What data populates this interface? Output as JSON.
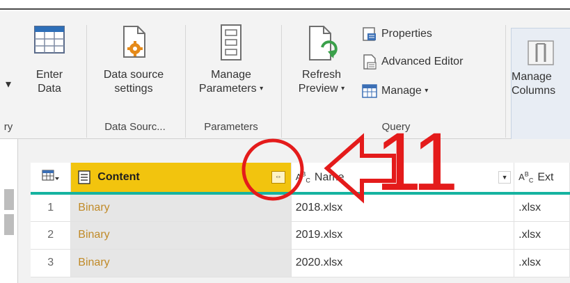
{
  "ribbon": {
    "left_partial": {
      "caret": "▾",
      "label": "ry"
    },
    "enter_data": {
      "line1": "Enter",
      "line2": "Data"
    },
    "data_source_settings": {
      "line1": "Data source",
      "line2": "settings"
    },
    "group_data_sources": "Data Sourc...",
    "manage_parameters": {
      "line1": "Manage",
      "line2": "Parameters",
      "caret": "▾"
    },
    "group_parameters": "Parameters",
    "refresh_preview": {
      "line1": "Refresh",
      "line2": "Preview",
      "caret": "▾"
    },
    "properties": "Properties",
    "advanced_editor": "Advanced Editor",
    "manage": {
      "label": "Manage",
      "caret": "▾"
    },
    "group_query": "Query",
    "manage_columns": {
      "line1": "Manage",
      "line2": "Columns"
    }
  },
  "grid": {
    "columns": [
      {
        "label": "Content",
        "type_icon": "binary-icon",
        "expand_symbol": "⇔"
      },
      {
        "label": "Name",
        "type_icon": "text-type-icon"
      },
      {
        "label": "Ext",
        "type_icon": "text-type-icon"
      }
    ],
    "rows": [
      {
        "index": "1",
        "content": "Binary",
        "name": "2018.xlsx",
        "ext": ".xlsx"
      },
      {
        "index": "2",
        "content": "Binary",
        "name": "2019.xlsx",
        "ext": ".xlsx"
      },
      {
        "index": "3",
        "content": "Binary",
        "name": "2020.xlsx",
        "ext": ".xlsx"
      }
    ]
  },
  "annotation": {
    "text": "11",
    "color": "#e41b1b"
  },
  "colors": {
    "header_content": "#f2c40e",
    "accent_line": "#16b3a0",
    "binary_text": "#c08a28"
  }
}
